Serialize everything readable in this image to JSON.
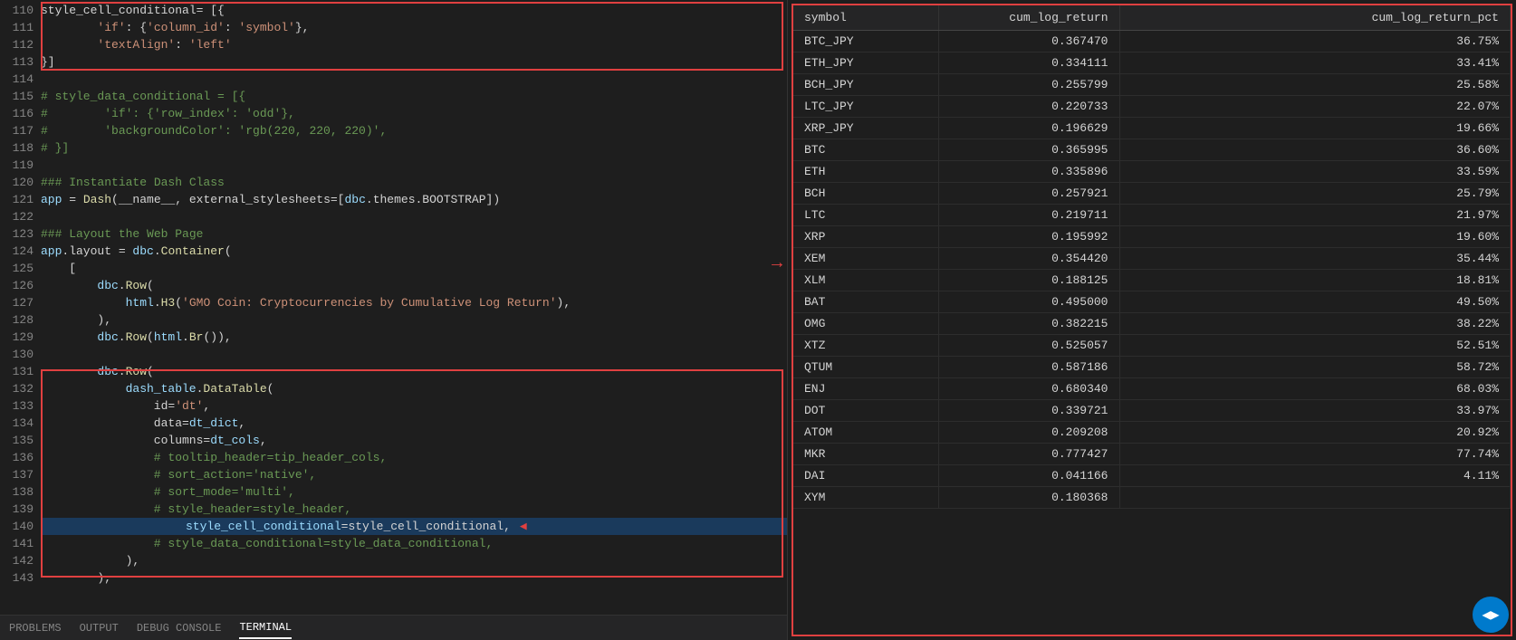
{
  "editor": {
    "lines": [
      {
        "num": 110,
        "text": "style_cell_conditional= [{",
        "type": "normal",
        "indent": 0
      },
      {
        "num": 111,
        "text": "        'if': {'column_id': 'symbol'},",
        "type": "normal",
        "indent": 0
      },
      {
        "num": 112,
        "text": "        'textAlign': 'left'",
        "type": "normal",
        "indent": 0
      },
      {
        "num": 113,
        "text": "}]",
        "type": "normal",
        "indent": 0
      },
      {
        "num": 114,
        "text": "",
        "type": "empty",
        "indent": 0
      },
      {
        "num": 115,
        "text": "# style_data_conditional = [{",
        "type": "comment",
        "indent": 0
      },
      {
        "num": 116,
        "text": "#        'if': {'row_index': 'odd'},",
        "type": "comment",
        "indent": 0
      },
      {
        "num": 117,
        "text": "#        'backgroundColor': 'rgb(220, 220, 220)',",
        "type": "comment",
        "indent": 0
      },
      {
        "num": 118,
        "text": "# }]",
        "type": "comment",
        "indent": 0
      },
      {
        "num": 119,
        "text": "",
        "type": "empty",
        "indent": 0
      },
      {
        "num": 120,
        "text": "### Instantiate Dash Class",
        "type": "comment3",
        "indent": 0
      },
      {
        "num": 121,
        "text": "app = Dash(__name__, external_stylesheets=[dbc.themes.BOOTSTRAP])",
        "type": "normal",
        "indent": 0
      },
      {
        "num": 122,
        "text": "",
        "type": "empty",
        "indent": 0
      },
      {
        "num": 123,
        "text": "### Layout the Web Page",
        "type": "comment3",
        "indent": 0
      },
      {
        "num": 124,
        "text": "app.layout = dbc.Container(",
        "type": "normal",
        "indent": 0
      },
      {
        "num": 125,
        "text": "    [",
        "type": "normal",
        "indent": 0
      },
      {
        "num": 126,
        "text": "        dbc.Row(",
        "type": "normal",
        "indent": 0
      },
      {
        "num": 127,
        "text": "            html.H3('GMO Coin: Cryptocurrencies by Cumulative Log Return'),",
        "type": "normal",
        "indent": 0
      },
      {
        "num": 128,
        "text": "        ),",
        "type": "normal",
        "indent": 0
      },
      {
        "num": 129,
        "text": "        dbc.Row(html.Br()),",
        "type": "normal",
        "indent": 0
      },
      {
        "num": 130,
        "text": "",
        "type": "empty",
        "indent": 0
      },
      {
        "num": 131,
        "text": "        dbc.Row(",
        "type": "normal",
        "indent": 0
      },
      {
        "num": 132,
        "text": "            dash_table.DataTable(",
        "type": "normal",
        "indent": 0
      },
      {
        "num": 133,
        "text": "                id='dt',",
        "type": "normal",
        "indent": 0
      },
      {
        "num": 134,
        "text": "                data=dt_dict,",
        "type": "normal",
        "indent": 0
      },
      {
        "num": 135,
        "text": "                columns=dt_cols,",
        "type": "normal",
        "indent": 0
      },
      {
        "num": 136,
        "text": "                # tooltip_header=tip_header_cols,",
        "type": "comment",
        "indent": 0
      },
      {
        "num": 137,
        "text": "                # sort_action='native',",
        "type": "comment",
        "indent": 0
      },
      {
        "num": 138,
        "text": "                # sort_mode='multi',",
        "type": "comment",
        "indent": 0
      },
      {
        "num": 139,
        "text": "                # style_header=style_header,",
        "type": "comment",
        "indent": 0
      },
      {
        "num": 140,
        "text": "                style_cell_conditional=style_cell_conditional,",
        "type": "highlight",
        "indent": 0
      },
      {
        "num": 141,
        "text": "                # style_data_conditional=style_data_conditional,",
        "type": "comment",
        "indent": 0
      },
      {
        "num": 142,
        "text": "            ),",
        "type": "normal",
        "indent": 0
      },
      {
        "num": 143,
        "text": "        ),",
        "type": "normal",
        "indent": 0
      }
    ]
  },
  "bottom_tabs": {
    "problems": "PROBLEMS",
    "output": "OUTPUT",
    "debug_console": "DEBUG CONSOLE",
    "terminal": "TERMINAL"
  },
  "table": {
    "headers": [
      "symbol",
      "cum_log_return",
      "cum_log_return_pct"
    ],
    "rows": [
      [
        "BTC_JPY",
        "0.367470",
        "36.75%"
      ],
      [
        "ETH_JPY",
        "0.334111",
        "33.41%"
      ],
      [
        "BCH_JPY",
        "0.255799",
        "25.58%"
      ],
      [
        "LTC_JPY",
        "0.220733",
        "22.07%"
      ],
      [
        "XRP_JPY",
        "0.196629",
        "19.66%"
      ],
      [
        "BTC",
        "0.365995",
        "36.60%"
      ],
      [
        "ETH",
        "0.335896",
        "33.59%"
      ],
      [
        "BCH",
        "0.257921",
        "25.79%"
      ],
      [
        "LTC",
        "0.219711",
        "21.97%"
      ],
      [
        "XRP",
        "0.195992",
        "19.60%"
      ],
      [
        "XEM",
        "0.354420",
        "35.44%"
      ],
      [
        "XLM",
        "0.188125",
        "18.81%"
      ],
      [
        "BAT",
        "0.495000",
        "49.50%"
      ],
      [
        "OMG",
        "0.382215",
        "38.22%"
      ],
      [
        "XTZ",
        "0.525057",
        "52.51%"
      ],
      [
        "QTUM",
        "0.587186",
        "58.72%"
      ],
      [
        "ENJ",
        "0.680340",
        "68.03%"
      ],
      [
        "DOT",
        "0.339721",
        "33.97%"
      ],
      [
        "ATOM",
        "0.209208",
        "20.92%"
      ],
      [
        "MKR",
        "0.777427",
        "77.74%"
      ],
      [
        "DAI",
        "0.041166",
        "4.11%"
      ],
      [
        "XYM",
        "0.180368",
        ""
      ]
    ]
  },
  "scroll_btn": {
    "label": "◀▶"
  }
}
